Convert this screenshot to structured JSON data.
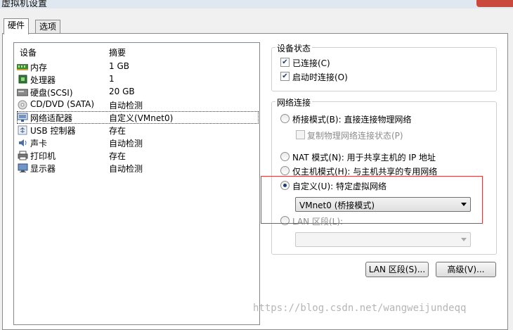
{
  "window": {
    "title": "虚拟机设置"
  },
  "tabs": [
    {
      "label": "硬件",
      "active": true
    },
    {
      "label": "选项",
      "active": false
    }
  ],
  "device_list": {
    "columns": {
      "device": "设备",
      "summary": "摘要"
    },
    "rows": [
      {
        "icon": "memory-icon",
        "name": "内存",
        "summary": "1 GB"
      },
      {
        "icon": "processor-icon",
        "name": "处理器",
        "summary": "1"
      },
      {
        "icon": "hard-disk-icon",
        "name": "硬盘(SCSI)",
        "summary": "20 GB"
      },
      {
        "icon": "cd-dvd-icon",
        "name": "CD/DVD (SATA)",
        "summary": "自动检测"
      },
      {
        "icon": "network-adapter-icon",
        "name": "网络适配器",
        "summary": "自定义(VMnet0)",
        "selected": true
      },
      {
        "icon": "usb-icon",
        "name": "USB 控制器",
        "summary": "存在"
      },
      {
        "icon": "sound-card-icon",
        "name": "声卡",
        "summary": "自动检测"
      },
      {
        "icon": "printer-icon",
        "name": "打印机",
        "summary": "存在"
      },
      {
        "icon": "display-icon",
        "name": "显示器",
        "summary": "自动检测"
      }
    ]
  },
  "device_status": {
    "title": "设备状态",
    "connected": {
      "label": "已连接(C)",
      "checked": true
    },
    "connect_at_power_on": {
      "label": "启动时连接(O)",
      "checked": true
    }
  },
  "network_connection": {
    "title": "网络连接",
    "bridged": {
      "label": "桥接模式(B): 直接连接物理网络",
      "checked": false
    },
    "replicate_state": {
      "label": "复制物理网络连接状态(P)",
      "checked": false,
      "disabled": true
    },
    "nat": {
      "label": "NAT 模式(N): 用于共享主机的 IP 地址",
      "checked": false
    },
    "host_only": {
      "label": "仅主机模式(H): 与主机共享的专用网络",
      "checked": false
    },
    "custom": {
      "label": "自定义(U): 特定虚拟网络",
      "checked": true
    },
    "custom_select_value": "VMnet0 (桥接模式)",
    "lan_segment": {
      "label": "LAN 区段(L):",
      "checked": false
    },
    "lan_select_value": ""
  },
  "buttons": {
    "lan_segments": "LAN 区段(S)...",
    "advanced": "高级(V)..."
  },
  "watermark": "https://blog.csdn.net/wangweijundeqq",
  "colors": {
    "highlight": "#d63a3a",
    "selection_text": "#000000"
  }
}
